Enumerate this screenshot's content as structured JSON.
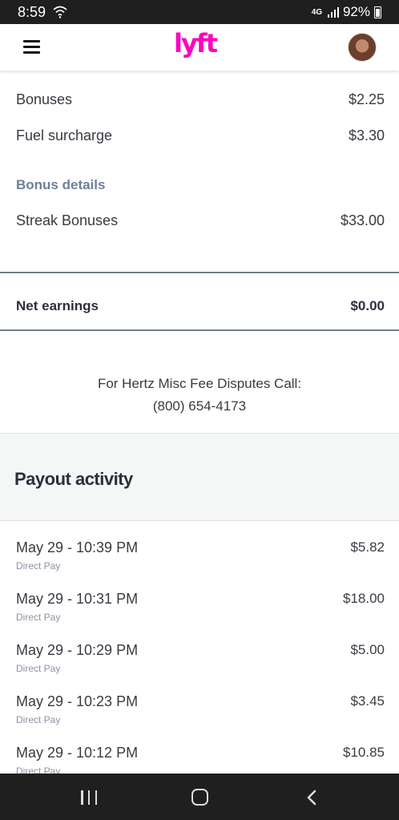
{
  "status_bar": {
    "time": "8:59",
    "network": "4G",
    "battery": "92%"
  },
  "header": {
    "logo_text": "lyft",
    "brand_color": "#ff00bf"
  },
  "earnings": {
    "rows": [
      {
        "label": "Bonuses",
        "value": "$2.25"
      },
      {
        "label": "Fuel surcharge",
        "value": "$3.30"
      }
    ],
    "bonus_section_title": "Bonus details",
    "bonus_rows": [
      {
        "label": "Streak Bonuses",
        "value": "$33.00"
      }
    ],
    "net_label": "Net earnings",
    "net_value": "$0.00"
  },
  "notice": {
    "line1": "For Hertz Misc Fee Disputes Call:",
    "line2": "(800) 654-4173"
  },
  "payout": {
    "title": "Payout activity",
    "items": [
      {
        "date": "May 29 - 10:39 PM",
        "method": "Direct Pay",
        "amount": "$5.82"
      },
      {
        "date": "May 29 - 10:31 PM",
        "method": "Direct Pay",
        "amount": "$18.00"
      },
      {
        "date": "May 29 - 10:29 PM",
        "method": "Direct Pay",
        "amount": "$5.00"
      },
      {
        "date": "May 29 - 10:23 PM",
        "method": "Direct Pay",
        "amount": "$3.45"
      },
      {
        "date": "May 29 - 10:12 PM",
        "method": "Direct Pay",
        "amount": "$10.85"
      }
    ]
  },
  "nav_bar": {
    "icons": [
      "recent-apps-icon",
      "home-icon",
      "back-icon"
    ]
  }
}
